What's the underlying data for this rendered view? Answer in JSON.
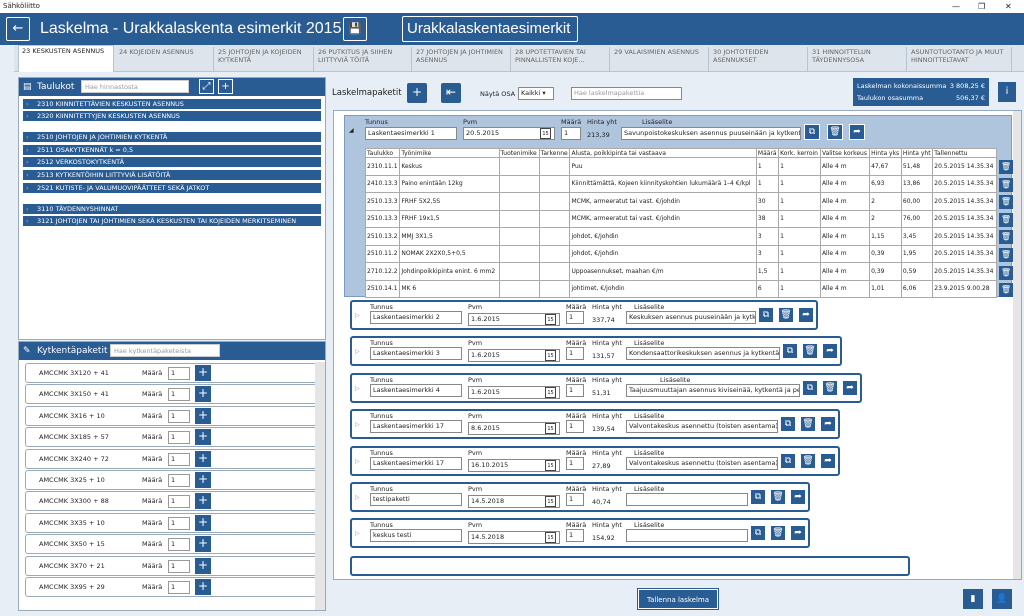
{
  "window": {
    "title": "Sähköliitto",
    "minimize": "—",
    "restore": "❐",
    "close": "✕"
  },
  "header": {
    "back_icon": "←",
    "title": "Laskelma - Urakkalaskenta esimerkit 2015",
    "save_icon": "💾",
    "name_value": "Urakkalaskentaesimerkit"
  },
  "tabs": [
    {
      "label": "23  KESKUSTEN ASENNUS"
    },
    {
      "label": "24  KOJEIDEN ASENNUS"
    },
    {
      "label": "25  JOHTOJEN JA KOJEIDEN KYTKENTÄ"
    },
    {
      "label": "26  PUTKITUS JA SIIHEN LIITTYVIÄ TÖITÄ"
    },
    {
      "label": "27  JOHTOJEN JA JOHTIMIEN ASENNUS"
    },
    {
      "label": "28  UPOTETTAVIEN TAI PINNALLISTEN KOJE..."
    },
    {
      "label": "29  VALAISIMIEN ASENNUS"
    },
    {
      "label": "30  JOHTOTEIDEN ASENNUKSET"
    },
    {
      "label": "31  HINNOITTELUN TÄYDENNYSOSA"
    },
    {
      "label": "ASUNTOTUOTANTO JA MUUT HINNOITTELTAVAT"
    }
  ],
  "taulukot": {
    "title": "Taulukot",
    "search_placeholder": "Hae hinnastosta",
    "expand_icon": "⤢",
    "add_icon": "+",
    "items": [
      "2310  KIINNITETTÄVIEN KESKUSTEN ASENNUS",
      "2320  KIINNITETTYJEN KESKUSTEN ASENNUS",
      "2510  JOHTOJEN JA JOHTIMIEN KYTKENTÄ",
      "2511  OSAKYTKENNÄT                k = 0,5",
      "2512  VERKOSTOKYTKENTÄ",
      "2513  KYTKENTÖIHIN LIITTYVIÄ LISÄTÖITÄ",
      "2521  KUTISTE- JA VALUMUOVIPÄÄTTEET SEKÄ JATKOT",
      "3110  TÄYDENNYSHINNAT",
      "3121  JOHTOJEN TAI JOHTIMIEN SEKÄ KESKUSTEN TAI KOJEIDEN MERKITSEMINEN"
    ]
  },
  "kytkenta": {
    "title": "Kytkentäpaketit",
    "search_placeholder": "Hae kytkentäpaketeista",
    "maara_label": "Määrä",
    "items": [
      {
        "name": "AMCCMK 3X120 + 41",
        "qty": "1"
      },
      {
        "name": "AMCCMK 3X150 + 41",
        "qty": "1"
      },
      {
        "name": "AMCCMK 3X16 + 10",
        "qty": "1"
      },
      {
        "name": "AMCCMK 3X185 + 57",
        "qty": "1"
      },
      {
        "name": "AMCCMK 3X240 + 72",
        "qty": "1"
      },
      {
        "name": "AMCCMK 3X25 + 10",
        "qty": "1"
      },
      {
        "name": "AMCCMK 3X300 + 88",
        "qty": "1"
      },
      {
        "name": "AMCCMK 3X35 + 10",
        "qty": "1"
      },
      {
        "name": "AMCCMK 3X50 + 15",
        "qty": "1"
      },
      {
        "name": "AMCCMK 3X70 + 21",
        "qty": "1"
      },
      {
        "name": "AMCCMK 3X95 + 29",
        "qty": "1"
      }
    ]
  },
  "main": {
    "title": "Laskelmapaketit",
    "add_icon": "+",
    "collapse_icon": "⇤",
    "nayta_label": "Näytä OSA",
    "nayta_value": "Kaikki",
    "search_placeholder": "Hae laskelmapakettia",
    "sum_label1": "Laskelman kokonaissumma",
    "sum_value1": "3 808,25 €",
    "sum_label2": "Taulukon osasumma",
    "sum_value2": "506,37 €",
    "info_icon": "i",
    "labels": {
      "tunnus": "Tunnus",
      "pvm": "Pvm",
      "maara": "Määrä",
      "hinta": "Hinta yht",
      "lisaselite": "Lisäselite"
    },
    "expanded": {
      "tunnus": "Laskentaesimerkki 1",
      "pvm": "20.5.2015",
      "maara": "1",
      "hinta": "213,39",
      "lisaselite": "Savunpoistokeskuksen asennus puuseinään ja kytkentä"
    },
    "table_headers": [
      "Taulukko",
      "Työnimike",
      "Tuotenimike",
      "Tarkenne",
      "Alusta, poikkipinta tai vastaava",
      "Määrä",
      "Kork. kerroin",
      "Valitse korkeus",
      "Hinta yks",
      "Hinta yht",
      "Tallennettu"
    ],
    "rows": [
      [
        "2310.11.1",
        "Keskus",
        "",
        "",
        "Puu",
        "1",
        "1",
        "Alle 4 m",
        "47,67",
        "51,48",
        "20.5.2015 14.35.34"
      ],
      [
        "2410.13.3",
        "Paino enintään 12kg",
        "",
        "",
        "Kiinnittämättä, Kojeen kiinnityskohtien lukumäärä 1–4 €/kpl",
        "1",
        "1",
        "Alle 4 m",
        "6,93",
        "13,86",
        "20.5.2015 14.35.34"
      ],
      [
        "2510.13.3",
        "FRHF 5X2,5S",
        "",
        "",
        "MCMK, armeeratut tai vast. €/johdin",
        "30",
        "1",
        "Alle 4 m",
        "2",
        "60,00",
        "20.5.2015 14.35.34"
      ],
      [
        "2510.13.3",
        "FRHF 19x1,5",
        "",
        "",
        "MCMK, armeeratut tai vast. €/johdin",
        "38",
        "1",
        "Alle 4 m",
        "2",
        "76,00",
        "20.5.2015 14.35.34"
      ],
      [
        "2510.13.2",
        "MMJ 3X1,5",
        "",
        "",
        "johdot, €/johdin",
        "3",
        "1",
        "Alle 4 m",
        "1,15",
        "3,45",
        "20.5.2015 14.35.34"
      ],
      [
        "2510.11.2",
        "NOMAK 2X2X0,5+0,5",
        "",
        "",
        "johdot, €/johdin",
        "3",
        "1",
        "Alle 4 m",
        "0,39",
        "1,95",
        "20.5.2015 14.35.34"
      ],
      [
        "2710.12.2",
        "Johdinpoikkipinta enint. 6 mm2",
        "",
        "",
        "Uppoasennukset, maahan €/m",
        "1,5",
        "1",
        "Alle 4 m",
        "0,39",
        "0,59",
        "20.5.2015 14.35.34"
      ],
      [
        "2510.14.1",
        "MK 6",
        "",
        "",
        "johtimet, €/johdin",
        "6",
        "1",
        "Alle 4 m",
        "1,01",
        "6,06",
        "23.9.2015 9.00.28"
      ]
    ],
    "packages": [
      {
        "tunnus": "Laskentaesimerkki 2",
        "pvm": "1.6.2015",
        "maara": "1",
        "hinta": "337,74",
        "lisaselite": "Keskuksen asennus puuseinään ja kytkentä"
      },
      {
        "tunnus": "Laskentaesimerkki 3",
        "pvm": "1.6.2015",
        "maara": "1",
        "hinta": "131,57",
        "lisaselite": "Kondensaattorikeskuksen asennus ja kytkentä"
      },
      {
        "tunnus": "Laskentaesimerkki 4",
        "pvm": "1.6.2015",
        "maara": "1",
        "hinta": "51,31",
        "lisaselite": "Taajuusmuuttajan asennus kiviseinää, kytkentä ja perussäätö"
      },
      {
        "tunnus": "Laskentaesimerkki 17",
        "pvm": "8.6.2015",
        "maara": "1",
        "hinta": "139,54",
        "lisaselite": "Valvontakeskus asennettu (toisten asentama)"
      },
      {
        "tunnus": "Laskentaesimerkki 17",
        "pvm": "16.10.2015",
        "maara": "1",
        "hinta": "27,89",
        "lisaselite": "Valvontakeskus asennettu (toisten asentama)"
      },
      {
        "tunnus": "testipaketti",
        "pvm": "14.5.2018",
        "maara": "1",
        "hinta": "40,74",
        "lisaselite": ""
      },
      {
        "tunnus": "keskus testi",
        "pvm": "14.5.2018",
        "maara": "1",
        "hinta": "154,92",
        "lisaselite": ""
      }
    ],
    "cal_icon": "15",
    "copy_icon": "⧉",
    "delete_icon": "🗑",
    "export_icon": "➦"
  },
  "footer": {
    "save_label": "Tallenna laskelma",
    "doc_icon": "▮",
    "user_icon": "👤"
  }
}
